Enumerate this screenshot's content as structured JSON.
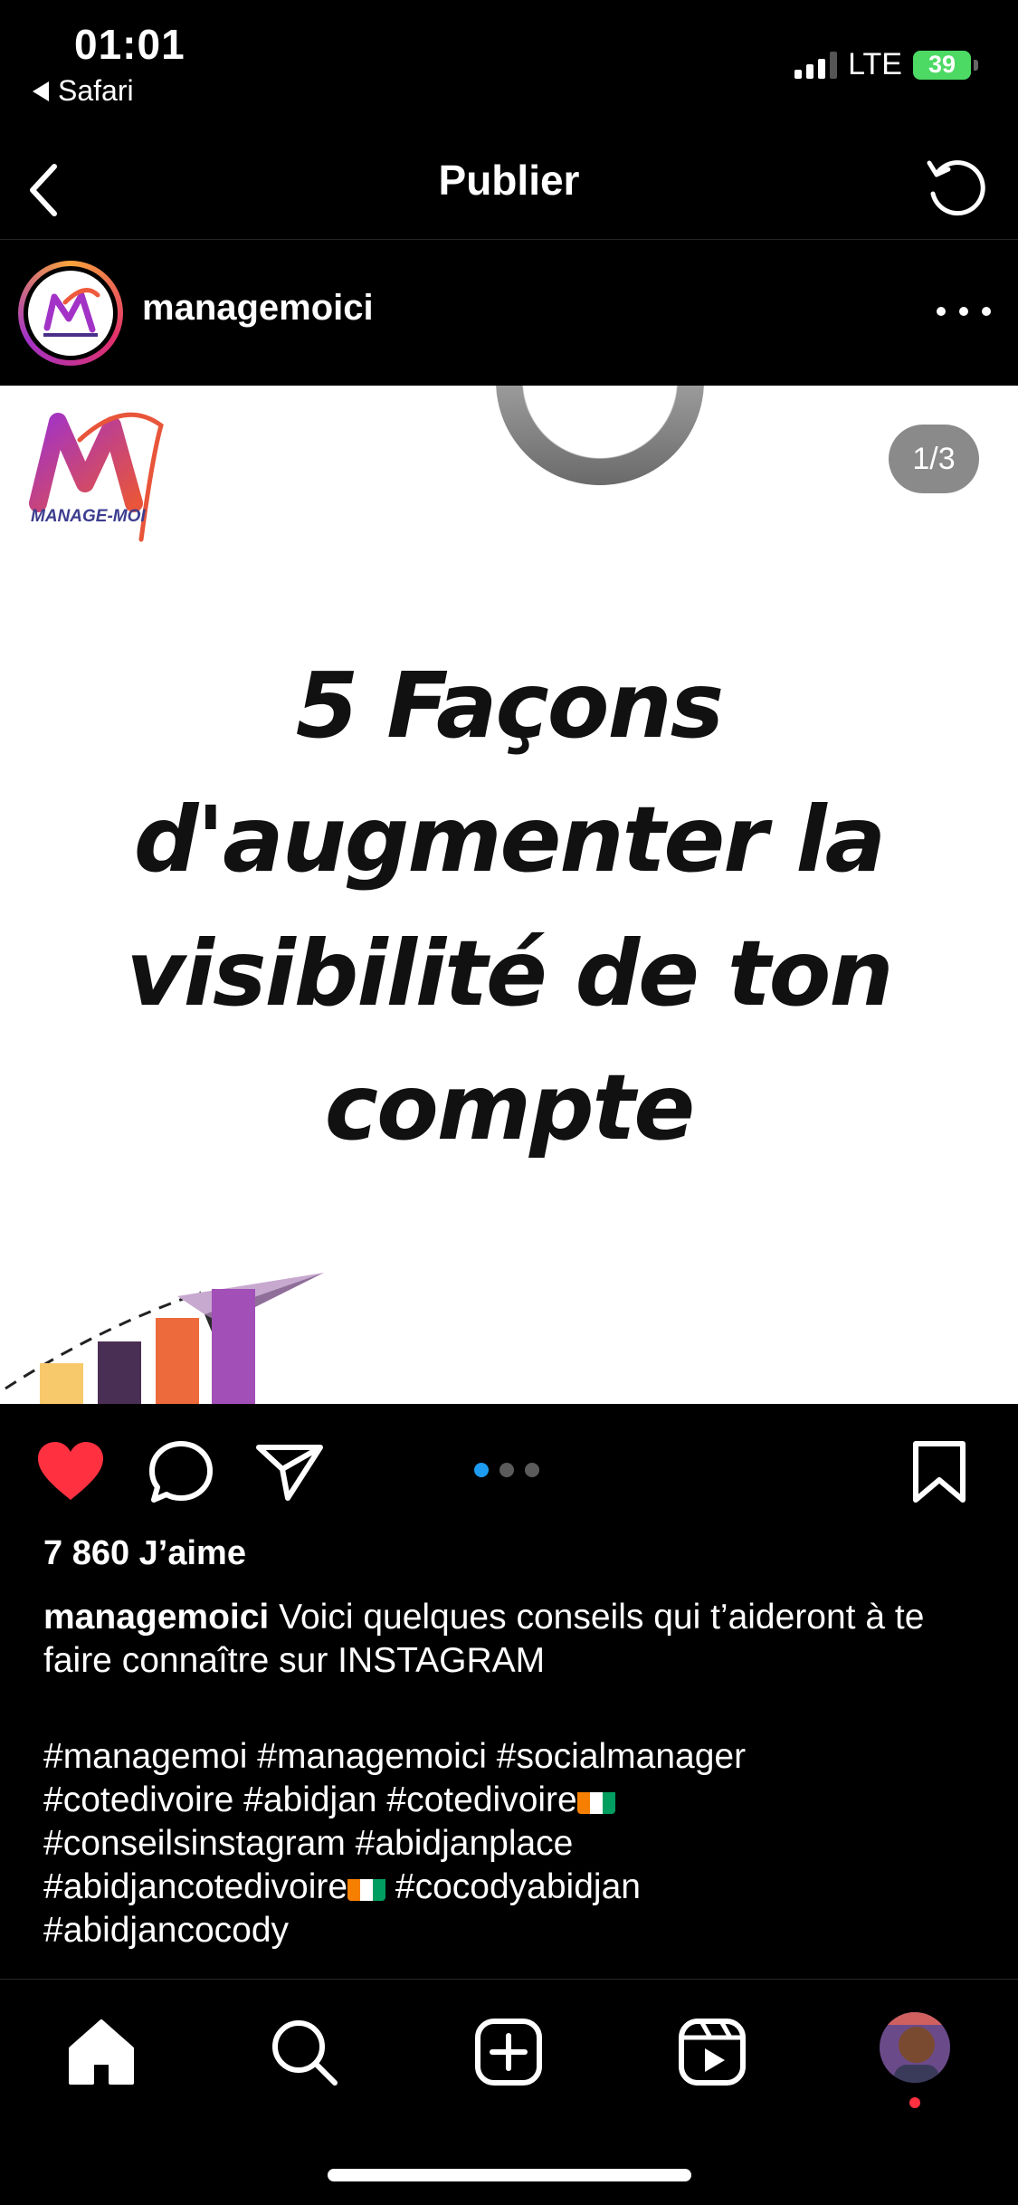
{
  "status_bar": {
    "time": "01:01",
    "back_app": "Safari",
    "network": "LTE",
    "battery": "39"
  },
  "nav": {
    "title": "Publier"
  },
  "post": {
    "username": "managemoici",
    "page_counter": "1/3",
    "slide_index": 1,
    "slide_total": 3,
    "brand_text": "MANAGE-MOI",
    "headline_lines": [
      "5 Façons",
      "d'augmenter la",
      "visibilité de ton",
      "compte"
    ],
    "likes": "7 860 J’aime",
    "caption_user": "managemoici",
    "caption_text": " Voici quelques conseils qui t’aideront à te faire connaître sur INSTAGRAM",
    "hashtags": {
      "line1": "#managemoi #managemoici #socialmanager",
      "line2": "#cotedivoire #abidjan #cotedivoire",
      "line3": "#conseilsinstagram #abidjanplace",
      "line4a": "#abidjancotedivoire",
      "line4b": " #cocodyabidjan",
      "line5": "#abidjancocody"
    }
  },
  "icons": {
    "like": "heart-icon",
    "comment": "comment-icon",
    "share": "send-icon",
    "save": "bookmark-icon"
  },
  "colors": {
    "like_red": "#ff3040",
    "active_dot": "#1d9bf0",
    "battery_green": "#4cd964",
    "bar_colors": [
      "#f7c96b",
      "#4a2f54",
      "#ed6a3c",
      "#a24fb8"
    ]
  }
}
